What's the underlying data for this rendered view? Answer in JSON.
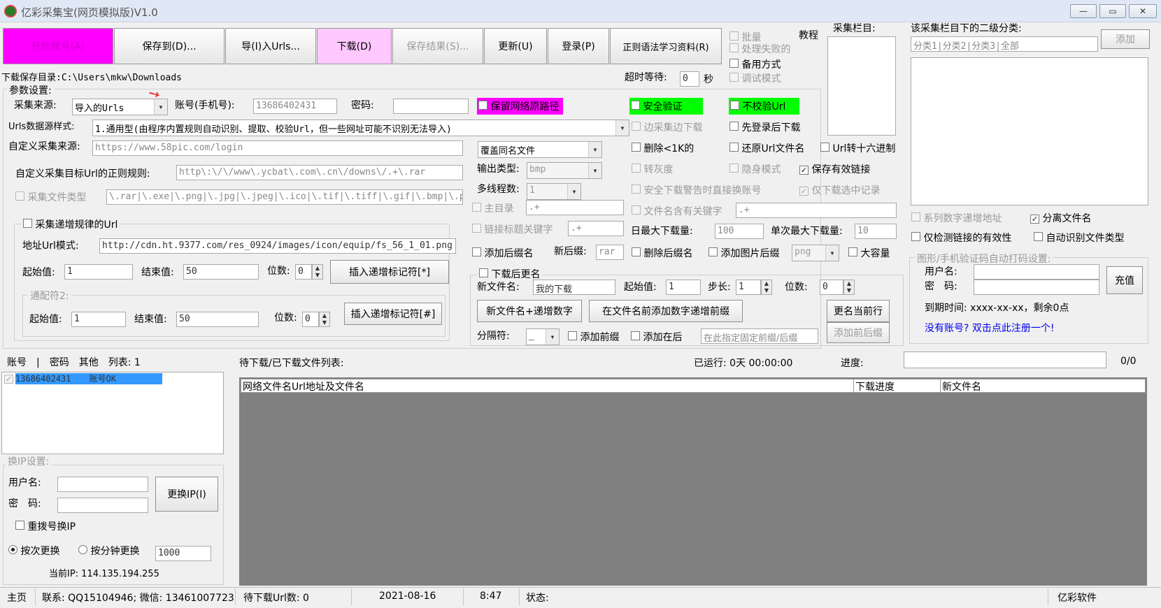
{
  "window": {
    "title": "亿彩采集宝(网页模拟版)V1.0",
    "min": "—",
    "max": "▭",
    "close": "✕"
  },
  "toolbar": {
    "start": "开始账号(A)",
    "save_to": "保存到(D)...",
    "import": "导(I)入Urls...",
    "download": "下载(D)",
    "save_result": "保存结果(S)...",
    "update": "更新(U)",
    "login": "登录(P)",
    "regex": "正则语法学习资料(R)"
  },
  "top_right": {
    "batch": "批量",
    "tutorial": "教程",
    "process_failed": "处理失败的",
    "backup": "备用方式",
    "debug": "调试模式",
    "timeout_label": "超时等待:",
    "timeout_value": "0",
    "timeout_unit": "秒",
    "column_label": "采集栏目:",
    "subcat_label": "该采集栏目下的二级分类:",
    "subcat_placeholder": "分类1|分类2|分类3|全部",
    "add_btn": "添加"
  },
  "download_dir": "下载保存目录:C:\\Users\\mkw\\Downloads",
  "params": {
    "title": "参数设置:",
    "source_label": "采集来源:",
    "source_value": "导入的Urls",
    "account_label": "账号(手机号):",
    "account_value": "13686402431",
    "password_label": "密码:",
    "keep_path": "保留网络原路径",
    "secure": "安全验证",
    "no_verify": "不校验Url",
    "url_style_label": "Urls数据源样式:",
    "url_style_value": "1.通用型(由程序内置规则自动识别、提取、校验Url，但一些网址可能不识别无法导入)",
    "custom_source_label": "自定义采集来源:",
    "custom_source_value": "https://www.58pic.com/login",
    "regex_label": "自定义采集目标Url的正则规则:",
    "regex_value": "http\\:\\/\\/www\\.ycbat\\.com\\.cn\\/downs\\/.+\\.rar",
    "filetype_label": "采集文件类型",
    "filetype_value": "\\.rar|\\.exe|\\.png|\\.jpg|\\.jpeg|\\.ico|\\.tif|\\.tiff|\\.gif|\\.bmp|\\.psd"
  },
  "incr": {
    "title": "采集递增规律的Url",
    "addr_label": "地址Url模式:",
    "addr_value": "http://cdn.ht.9377.com/res_0924/images/icon/equip/fs_56_1_01.png",
    "start_label": "起始值:",
    "start_value": "1",
    "end_label": "结束值:",
    "end_value": "50",
    "digits_label": "位数:",
    "digits_value": "0",
    "insert1": "插入递增标记符[*]",
    "wildcard_title": "通配符2:",
    "start2": "1",
    "end2": "50",
    "digits2": "0",
    "insert2": "插入递增标记符[#]"
  },
  "mid": {
    "overwrite": "覆盖同名文件",
    "output_label": "输出类型:",
    "output_value": "bmp",
    "threads_label": "多线程数:",
    "threads_value": "1",
    "main_dir": "主目录",
    "main_dir_value": ".+",
    "link_kw": "链接标题关键字",
    "link_kw_value": ".+",
    "add_suffix": "添加后缀名",
    "new_suffix_label": "新后缀:",
    "new_suffix_value": "rar",
    "rename": "下载后更名",
    "newname_label": "新文件名:",
    "newname_value": "我的下载",
    "start_label": "起始值:",
    "start_value": "1",
    "step_label": "步长:",
    "step_value": "1",
    "digits_label": "位数:",
    "digits_value": "0",
    "btn_newname": "新文件名+递增数字",
    "btn_prefix": "在文件名前添加数字递增前缀",
    "btn_rename_row": "更名当前行",
    "sep_label": "分隔符:",
    "sep_value": "_",
    "add_prefix": "添加前缀",
    "add_after": "添加在后",
    "fixed_placeholder": "在此指定固定前缀/后缀",
    "btn_add_prefix": "添加前后缀"
  },
  "opts": {
    "edge": "边采集边下载",
    "login_first": "先登录后下载",
    "del_1k": "删除<1K的",
    "restore": "还原Url文件名",
    "hex": "Url转十六进制",
    "grayscale": "转灰度",
    "hidden": "隐身模式",
    "save_valid": "保存有效链接",
    "warn_switch": "安全下载警告时直接换账号",
    "only_selected": "仅下载选中记录",
    "kw_in_name": "文件名含有关键字",
    "kw_value": ".+",
    "daily_max_label": "日最大下载量:",
    "daily_max": "100",
    "single_max_label": "单次最大下载量:",
    "single_max": "10",
    "del_suffix": "删除后缀名",
    "add_img_suffix": "添加图片后缀",
    "img_suffix": "png",
    "large": "大容量"
  },
  "right_opts": {
    "serial": "系列数字递增地址",
    "split": "分离文件名",
    "check_valid": "仅检测链接的有效性",
    "auto_type": "自动识别文件类型",
    "captcha_title": "图形/手机验证码自动打码设置:",
    "user_label": "用户名:",
    "pwd_label": "密　码:",
    "recharge": "充值",
    "expire": "到期时间: xxxx-xx-xx，剩余0点",
    "register": "没有账号? 双击点此注册一个!"
  },
  "accounts": {
    "h_account": "账号",
    "h_sep": "|",
    "h_pwd": "密码",
    "h_other": "其他",
    "h_count": "列表: 1",
    "row_account": "13686402431",
    "row_status": "账号OK"
  },
  "files": {
    "title": "待下载/已下载文件列表:",
    "runtime": "已运行: 0天 00:00:00",
    "progress_label": "进度:",
    "progress_value": "0/0",
    "col_url": "网络文件名Url地址及文件名",
    "col_progress": "下载进度",
    "col_newname": "新文件名"
  },
  "ip": {
    "title": "换IP设置:",
    "user_label": "用户名:",
    "pwd_label": "密　码:",
    "change_btn": "更换IP(I)",
    "redial": "重拨号换IP",
    "by_count": "按次更换",
    "by_minute": "按分钟更换",
    "interval": "1000",
    "current_ip": "当前IP: 114.135.194.255"
  },
  "status": {
    "home": "主页",
    "contact": "联系: QQ15104946; 微信: 13461007723",
    "pending": "待下载Url数: 0",
    "date": "2021-08-16",
    "time": "8:47",
    "state": "状态:",
    "brand": "亿彩软件"
  },
  "colors": {
    "magenta": "#ff00ff",
    "pink": "#ffc8ff",
    "green": "#00ff00",
    "selection": "#3399ff",
    "link": "#0000ee"
  }
}
